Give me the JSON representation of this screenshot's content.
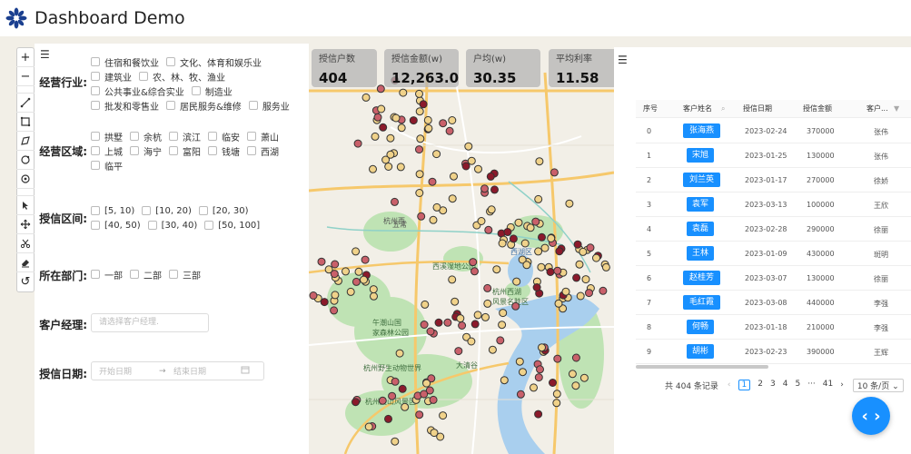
{
  "app": {
    "title": "Dashboard Demo"
  },
  "toolbar": {
    "zoom_in": "+",
    "zoom_out": "−",
    "undo": "↺"
  },
  "filters": {
    "industry": {
      "label": "经营行业:",
      "options": [
        "住宿和餐饮业",
        "文化、体育和娱乐业",
        "建筑业",
        "农、林、牧、渔业",
        "公共事业&综合实业",
        "制造业",
        "批发和零售业",
        "居民服务&维修",
        "服务业"
      ]
    },
    "region": {
      "label": "经营区域:",
      "options": [
        "拱墅",
        "余杭",
        "滨江",
        "临安",
        "萧山",
        "上城",
        "海宁",
        "富阳",
        "钱塘",
        "西湖",
        "临平"
      ]
    },
    "credit_range": {
      "label": "授信区间:",
      "options": [
        "[5, 10)",
        "[10, 20)",
        "[20, 30)",
        "[40, 50)",
        "[30, 40)",
        "[50, 100]"
      ]
    },
    "department": {
      "label": "所在部门:",
      "options": [
        "一部",
        "二部",
        "三部"
      ]
    },
    "manager": {
      "label": "客户经理:",
      "placeholder": "请选择客户经理."
    },
    "date": {
      "label": "授信日期:",
      "start_placeholder": "开始日期",
      "end_placeholder": "结束日期",
      "arrow": "→"
    }
  },
  "stats": [
    {
      "label": "授信户数",
      "value": "404"
    },
    {
      "label": "授信金额(w)",
      "value": "12,263.0"
    },
    {
      "label": "户均(w)",
      "value": "30.35"
    },
    {
      "label": "平均利率",
      "value": "11.58"
    }
  ],
  "table": {
    "columns": [
      "序号",
      "客户姓名",
      "授信日期",
      "授信金额",
      "客户..."
    ],
    "rows": [
      {
        "idx": "0",
        "name": "张海燕",
        "date": "2023-02-24",
        "amount": "370000",
        "manager": "张伟"
      },
      {
        "idx": "1",
        "name": "宋旭",
        "date": "2023-01-25",
        "amount": "130000",
        "manager": "张伟"
      },
      {
        "idx": "2",
        "name": "刘兰英",
        "date": "2023-01-17",
        "amount": "270000",
        "manager": "徐娇"
      },
      {
        "idx": "3",
        "name": "袁军",
        "date": "2023-03-13",
        "amount": "100000",
        "manager": "王欣"
      },
      {
        "idx": "4",
        "name": "袁磊",
        "date": "2023-02-28",
        "amount": "290000",
        "manager": "徐丽"
      },
      {
        "idx": "5",
        "name": "王林",
        "date": "2023-01-09",
        "amount": "430000",
        "manager": "斑明"
      },
      {
        "idx": "6",
        "name": "赵桂芳",
        "date": "2023-03-07",
        "amount": "130000",
        "manager": "徐丽"
      },
      {
        "idx": "7",
        "name": "毛红霞",
        "date": "2023-03-08",
        "amount": "440000",
        "manager": "李强"
      },
      {
        "idx": "8",
        "name": "何畅",
        "date": "2023-01-18",
        "amount": "210000",
        "manager": "李强"
      },
      {
        "idx": "9",
        "name": "胡彬",
        "date": "2023-02-23",
        "amount": "390000",
        "manager": "王辉"
      }
    ]
  },
  "pagination": {
    "total": "共 404 条记录",
    "prev": "‹",
    "pages": [
      "1",
      "2",
      "3",
      "4",
      "5",
      "···",
      "41"
    ],
    "next": "›",
    "page_size": "10 条/页"
  },
  "map_labels": {
    "west_lake": "西湖区",
    "wetland": "西溪湿地公园",
    "scenic": "杭州西湖\n风景名胜区",
    "forest": "午潮山国\n家森林公园",
    "wildlife": "杭州野生动物世界",
    "lingshan": "杭州灵山风景区",
    "daqingu": "大清谷",
    "wuchao": "五常",
    "yuhang": "杭州西"
  },
  "colors": {
    "accent": "#1890ff",
    "marker_fill": "#f0d28a",
    "marker_dark": "#8b1a2b"
  }
}
